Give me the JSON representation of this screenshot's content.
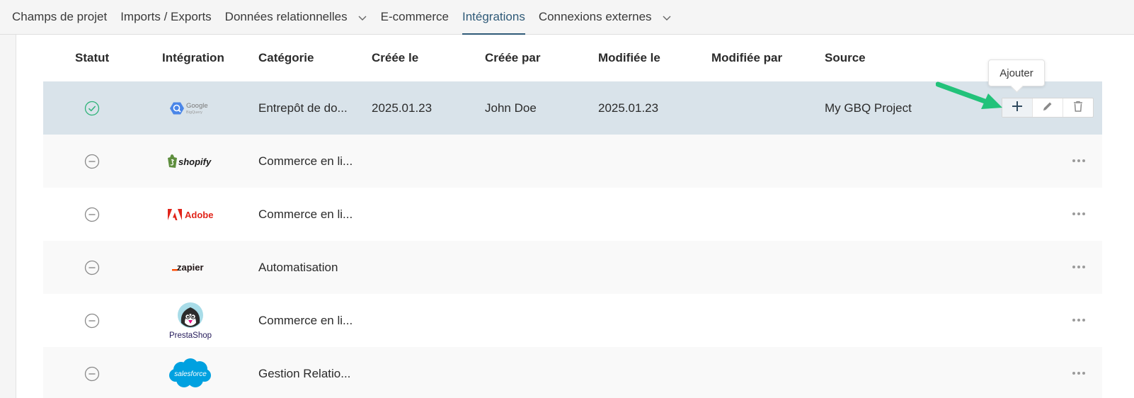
{
  "tabs": [
    {
      "label": "Champs de projet",
      "active": false,
      "dropdown": false
    },
    {
      "label": "Imports / Exports",
      "active": false,
      "dropdown": false
    },
    {
      "label": "Données relationnelles",
      "active": false,
      "dropdown": true
    },
    {
      "label": "E-commerce",
      "active": false,
      "dropdown": false
    },
    {
      "label": "Intégrations",
      "active": true,
      "dropdown": false
    },
    {
      "label": "Connexions externes",
      "active": false,
      "dropdown": true
    }
  ],
  "table": {
    "headers": {
      "status": "Statut",
      "integration": "Intégration",
      "category": "Catégorie",
      "created_on": "Créée le",
      "created_by": "Créée par",
      "modified_on": "Modifiée le",
      "modified_by": "Modifiée par",
      "source": "Source"
    },
    "rows": [
      {
        "status": "active",
        "logo": "google-bigquery-logo",
        "logo_text": "Google",
        "logo_subtext": "BigQuery",
        "category": "Entrepôt de do...",
        "created_on": "2025.01.23",
        "created_by": "John Doe",
        "modified_on": "2025.01.23",
        "modified_by": "",
        "source": "My GBQ Project",
        "selected": true
      },
      {
        "status": "inactive",
        "logo": "shopify-logo",
        "logo_text": "shopify",
        "category": "Commerce en li...",
        "created_on": "",
        "created_by": "",
        "modified_on": "",
        "modified_by": "",
        "source": ""
      },
      {
        "status": "inactive",
        "logo": "adobe-logo",
        "logo_text": "Adobe",
        "category": "Commerce en li...",
        "created_on": "",
        "created_by": "",
        "modified_on": "",
        "modified_by": "",
        "source": ""
      },
      {
        "status": "inactive",
        "logo": "zapier-logo",
        "logo_text": "zapier",
        "category": "Automatisation",
        "created_on": "",
        "created_by": "",
        "modified_on": "",
        "modified_by": "",
        "source": ""
      },
      {
        "status": "inactive",
        "logo": "prestashop-logo",
        "logo_text": "PrestaShop",
        "category": "Commerce en li...",
        "created_on": "",
        "created_by": "",
        "modified_on": "",
        "modified_by": "",
        "source": ""
      },
      {
        "status": "inactive",
        "logo": "salesforce-logo",
        "logo_text": "salesforce",
        "category": "Gestion Relatio...",
        "created_on": "",
        "created_by": "",
        "modified_on": "",
        "modified_by": "",
        "source": ""
      }
    ]
  },
  "row_actions": {
    "tooltip": "Ajouter",
    "icons": [
      "plus-icon",
      "pencil-icon",
      "trash-icon"
    ]
  },
  "colors": {
    "accent": "#2f5a78",
    "selected_row": "#d9e3ea",
    "status_active": "#2fb379",
    "status_inactive": "#8a8a8a",
    "annotation_arrow": "#22c27a"
  }
}
